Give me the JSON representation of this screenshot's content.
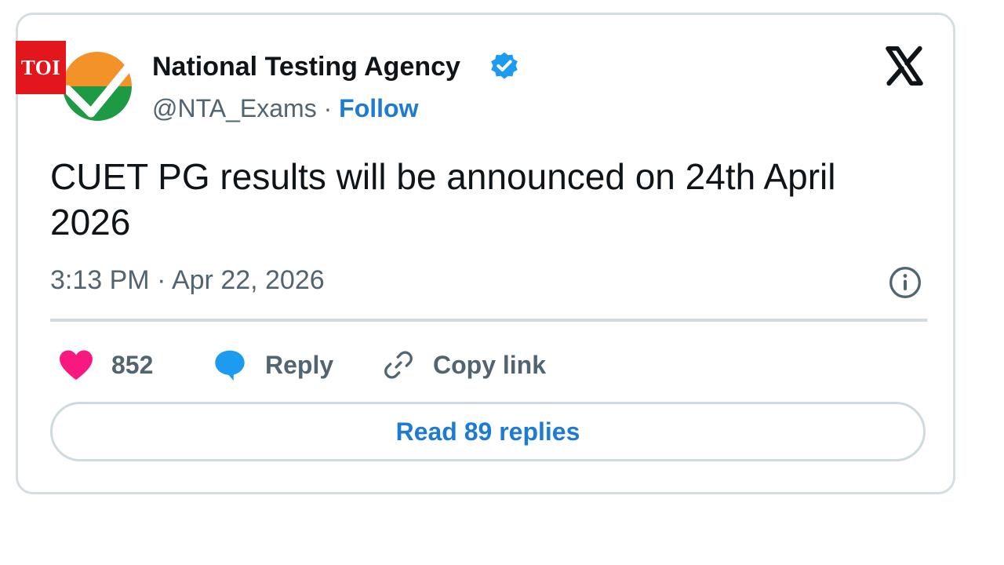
{
  "badge": {
    "text": "TOI",
    "color": "#e3161b"
  },
  "author": {
    "name": "National Testing Agency",
    "handle": "@NTA_Exams",
    "separator": " · ",
    "follow_label": "Follow",
    "verified": true
  },
  "tweet": {
    "text": "CUET PG results will be announced on 24th April 2026",
    "timestamp": "3:13 PM · Apr 22, 2026"
  },
  "actions": {
    "likes_count": "852",
    "reply_label": "Reply",
    "copy_link_label": "Copy link"
  },
  "replies_button_label": "Read 89 replies",
  "icons": [
    "verified-badge-icon",
    "x-logo-icon",
    "info-icon",
    "heart-icon",
    "reply-bubble-icon",
    "link-icon"
  ],
  "colors": {
    "accent": "#1d7bd3",
    "like": "#f91880",
    "text": "#0f1419",
    "muted": "#536471",
    "border": "#cfd9de"
  }
}
